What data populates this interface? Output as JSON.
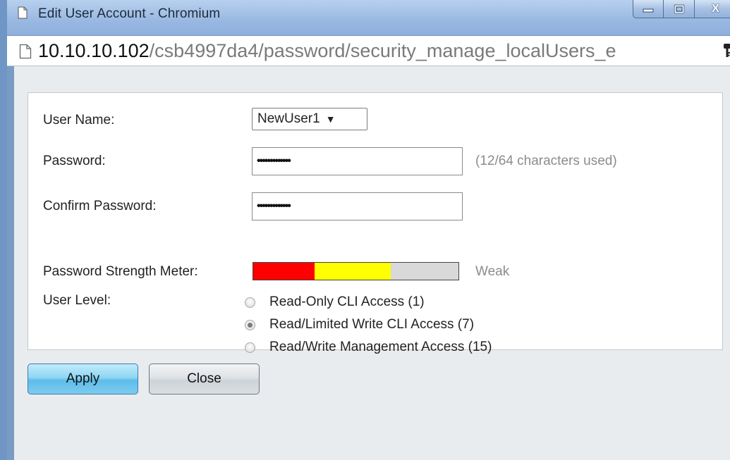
{
  "window": {
    "title": "Edit User Account - Chromium",
    "controls": {
      "minimize": "▁",
      "maximize": "▢",
      "close": "X"
    }
  },
  "address_bar": {
    "host": "10.10.10.102",
    "path": "/csb4997da4/password/security_manage_localUsers_e"
  },
  "form": {
    "user_name": {
      "label": "User Name:",
      "selected": "NewUser1"
    },
    "password": {
      "label": "Password:",
      "masked_value": "•••••••••••••",
      "hint": "(12/64 characters used)"
    },
    "confirm_password": {
      "label": "Confirm Password:",
      "masked_value": "•••••••••••••"
    },
    "strength_meter": {
      "label": "Password Strength Meter:",
      "strength_text": "Weak",
      "segments": [
        {
          "color": "#ff0000",
          "fraction": 0.3
        },
        {
          "color": "#ffff00",
          "fraction": 0.37
        },
        {
          "color": "#d9d9d9",
          "fraction": 0.33
        }
      ]
    },
    "user_level": {
      "label": "User Level:",
      "options": [
        {
          "label": "Read-Only CLI Access (1)",
          "checked": false
        },
        {
          "label": "Read/Limited Write CLI Access (7)",
          "checked": true
        },
        {
          "label": "Read/Write Management Access (15)",
          "checked": false
        }
      ]
    }
  },
  "buttons": {
    "apply": "Apply",
    "close": "Close"
  },
  "colors": {
    "apply_button": "#5cbdea",
    "panel_bg": "#ffffff",
    "page_bg": "#e9ecee",
    "title_bar": "#98b8e2"
  }
}
